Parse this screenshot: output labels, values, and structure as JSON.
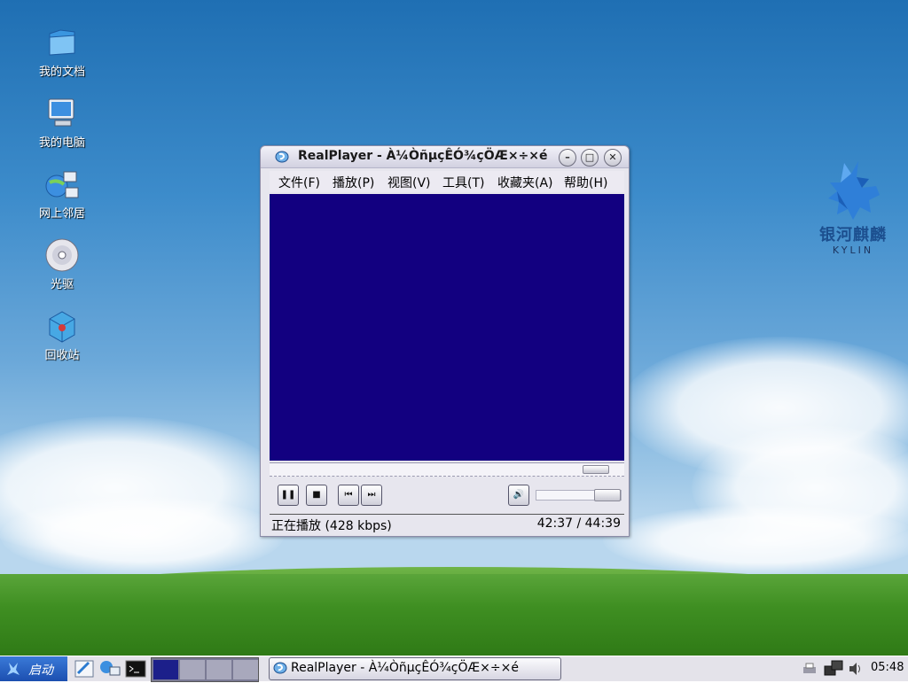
{
  "desktop": {
    "icons": [
      {
        "label": "我的文档",
        "icon": "folder-icon"
      },
      {
        "label": "我的电脑",
        "icon": "computer-icon"
      },
      {
        "label": "网上邻居",
        "icon": "network-icon"
      },
      {
        "label": "光驱",
        "icon": "cdrom-icon"
      },
      {
        "label": "回收站",
        "icon": "trash-icon"
      }
    ],
    "logo": {
      "cn": "银河麒麟",
      "en": "KYLIN"
    }
  },
  "player": {
    "title": "RealPlayer - À¼ÒñµçÊÓ¾çÖÆ×÷×é",
    "menu": [
      "文件(F)",
      "播放(P)",
      "视图(V)",
      "工具(T)",
      "收藏夹(A)",
      "帮助(H)"
    ],
    "status_left": "正在播放 (428 kbps)",
    "status_right": "42:37 / 44:39",
    "seek_fraction": 0.955,
    "volume_fraction": 1.0,
    "video_color": "#120080"
  },
  "taskbar": {
    "start_label": "启动",
    "task_title": "RealPlayer - À¼ÒñµçÊÓ¾çÖÆ×÷×é",
    "clock": "05:48",
    "workspaces": 4,
    "active_workspace": 1
  },
  "colors": {
    "accent": "#1c4fb0",
    "window_bg": "#e7e6ee"
  }
}
